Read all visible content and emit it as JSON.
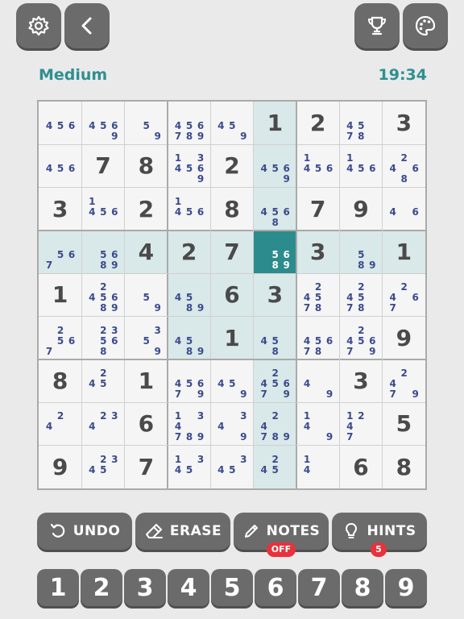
{
  "header": {
    "difficulty": "Medium",
    "timer": "19:34"
  },
  "icons": {
    "settings": "gear-icon",
    "back": "chevron-left-icon",
    "trophy": "trophy-icon",
    "theme": "palette-icon"
  },
  "colors": {
    "accent": "#2f8f90",
    "selected_cell": "#2c8b8c",
    "highlight": "#d9e8e8",
    "note_text": "#3a4a8e",
    "button": "#6b6b6b",
    "badge": "#e8323c"
  },
  "board": {
    "selected": [
      3,
      5
    ],
    "cells": [
      [
        {
          "n": "456"
        },
        {
          "n": "4569"
        },
        {
          "n": "59"
        },
        {
          "n": "456789"
        },
        {
          "n": "459"
        },
        {
          "v": "1"
        },
        {
          "v": "2"
        },
        {
          "n": "4578"
        },
        {
          "v": "3"
        }
      ],
      [
        {
          "n": "456"
        },
        {
          "v": "7"
        },
        {
          "v": "8"
        },
        {
          "n": "134569"
        },
        {
          "v": "2"
        },
        {
          "n": "4569"
        },
        {
          "n": "1456"
        },
        {
          "n": "1456"
        },
        {
          "n": "2468"
        }
      ],
      [
        {
          "v": "3"
        },
        {
          "n": "1456"
        },
        {
          "v": "2"
        },
        {
          "n": "1456"
        },
        {
          "v": "8"
        },
        {
          "n": "4568"
        },
        {
          "v": "7"
        },
        {
          "v": "9"
        },
        {
          "n": "46"
        }
      ],
      [
        {
          "n": "567"
        },
        {
          "n": "5689"
        },
        {
          "v": "4"
        },
        {
          "v": "2"
        },
        {
          "v": "7"
        },
        {
          "n": "5689"
        },
        {
          "v": "3"
        },
        {
          "n": "589"
        },
        {
          "v": "1"
        }
      ],
      [
        {
          "v": "1"
        },
        {
          "n": "245689"
        },
        {
          "n": "59"
        },
        {
          "n": "4589"
        },
        {
          "v": "6"
        },
        {
          "v": "3"
        },
        {
          "n": "24578"
        },
        {
          "n": "24578"
        },
        {
          "n": "2467"
        }
      ],
      [
        {
          "n": "2567"
        },
        {
          "n": "23568"
        },
        {
          "n": "359"
        },
        {
          "n": "4589"
        },
        {
          "v": "1"
        },
        {
          "n": "458"
        },
        {
          "n": "45678"
        },
        {
          "n": "245679"
        },
        {
          "v": "9"
        }
      ],
      [
        {
          "v": "8"
        },
        {
          "n": "245"
        },
        {
          "v": "1"
        },
        {
          "n": "45679"
        },
        {
          "n": "459"
        },
        {
          "n": "245679"
        },
        {
          "n": "49"
        },
        {
          "v": "3"
        },
        {
          "n": "2479"
        }
      ],
      [
        {
          "n": "24"
        },
        {
          "n": "234"
        },
        {
          "v": "6"
        },
        {
          "n": "134789"
        },
        {
          "n": "349"
        },
        {
          "n": "24789"
        },
        {
          "n": "149"
        },
        {
          "n": "1247"
        },
        {
          "v": "5"
        }
      ],
      [
        {
          "v": "9"
        },
        {
          "n": "2345"
        },
        {
          "v": "7"
        },
        {
          "n": "1345"
        },
        {
          "n": "345"
        },
        {
          "n": "245"
        },
        {
          "n": "14"
        },
        {
          "v": "6"
        },
        {
          "v": "8"
        }
      ]
    ]
  },
  "actions": [
    {
      "label": "UNDO",
      "icon": "undo-icon"
    },
    {
      "label": "ERASE",
      "icon": "eraser-icon"
    },
    {
      "label": "NOTES",
      "icon": "pencil-icon",
      "badge": "OFF"
    },
    {
      "label": "HINTS",
      "icon": "lightbulb-icon",
      "badge": "5"
    }
  ],
  "numpad": [
    "1",
    "2",
    "3",
    "4",
    "5",
    "6",
    "7",
    "8",
    "9"
  ]
}
